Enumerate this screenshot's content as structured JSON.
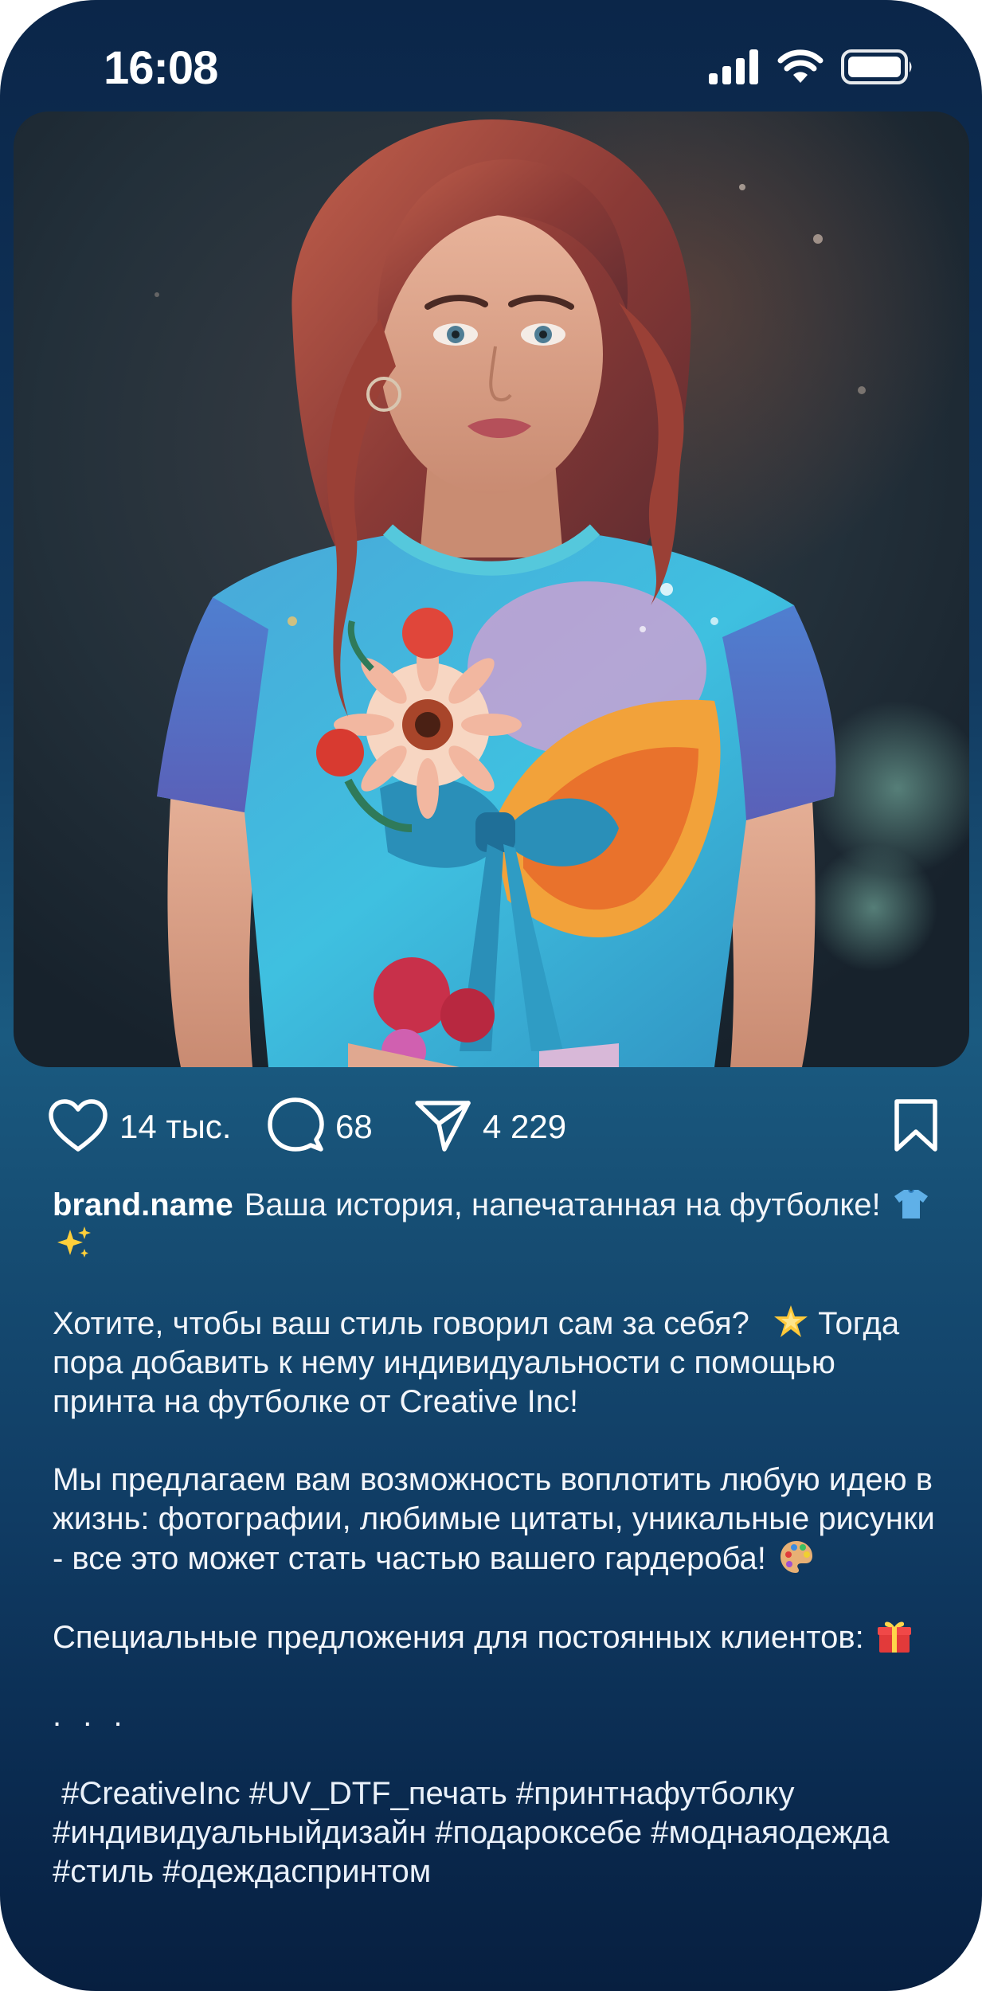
{
  "status_bar": {
    "time": "16:08",
    "icons": [
      "cellular-signal-icon",
      "wifi-icon",
      "battery-icon"
    ]
  },
  "post": {
    "image": {
      "subject": "woman-in-printed-tshirt-photo",
      "background_color": "#1f2a34",
      "tshirt_color": "#3fb8d6",
      "hair_color": "#a34a3c"
    },
    "actions": {
      "like_icon": "heart-icon",
      "likes": "14 тыс.",
      "comment_icon": "speech-bubble-icon",
      "comments": "68",
      "share_icon": "paper-plane-icon",
      "shares": "4 229",
      "save_icon": "bookmark-icon"
    },
    "caption": {
      "username": "brand.name",
      "line1": "Ваша история, напечатанная на футболке!",
      "line1_emojis": [
        "t-shirt-emoji",
        "sparkles-emoji"
      ],
      "para2": "Хотите, чтобы ваш стиль говорил сам за себя?",
      "para2_emoji": "star-emoji",
      "para2_rest": "Тогда пора добавить к нему индивидуальности с помощью  принта на футболке от Creative Inc!",
      "para3": "Мы предлагаем вам возможность воплотить любую идею в жизнь:  фотографии, любимые цитаты, уникальные рисунки - все это может стать частью вашего гардероба!",
      "para3_emoji": "palette-emoji",
      "para4": "Специальные предложения для постоянных клиентов:",
      "para4_emoji": "gift-emoji",
      "ellipsis": ". . .",
      "hashtags": " #CreativeInc #UV_DTF_печать #принтнафутболку #индивидуальныйдизайн #подароксебе #моднаяодежда #стиль #одеждаспринтом"
    }
  },
  "colors": {
    "gradient_top": "#0b2649",
    "gradient_mid": "#1a5a80",
    "gradient_bottom": "#071f40",
    "text": "#ffffff"
  }
}
